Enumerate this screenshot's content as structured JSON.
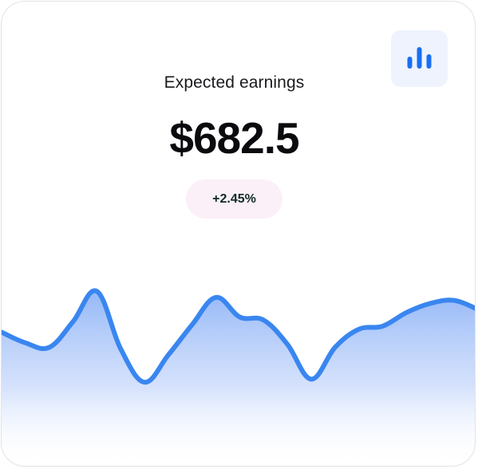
{
  "card": {
    "title": "Expected earnings",
    "amount": "$682.5",
    "change_badge": "+2.45%",
    "icon": "bar-chart-icon"
  },
  "chart_data": {
    "type": "area",
    "title": "",
    "xlabel": "",
    "ylabel": "",
    "x": [
      0,
      5,
      10,
      15,
      20,
      25,
      30,
      35,
      40,
      45,
      50,
      55,
      60,
      65,
      70,
      75,
      80,
      85,
      90,
      95,
      100
    ],
    "values": [
      45,
      38,
      35,
      52,
      72,
      34,
      12,
      30,
      50,
      68,
      55,
      53,
      37,
      14,
      35,
      47,
      49,
      58,
      64,
      66,
      60
    ],
    "ylim": [
      0,
      100
    ],
    "grid": false,
    "legend": "none"
  },
  "colors": {
    "line": "#3a86f0",
    "fill_top": "#8fb4f6",
    "fill_bottom": "#ffffff",
    "icon": "#1a6ef1",
    "icon_bg": "#eef3fe",
    "badge_bg": "#fbf0f8"
  }
}
